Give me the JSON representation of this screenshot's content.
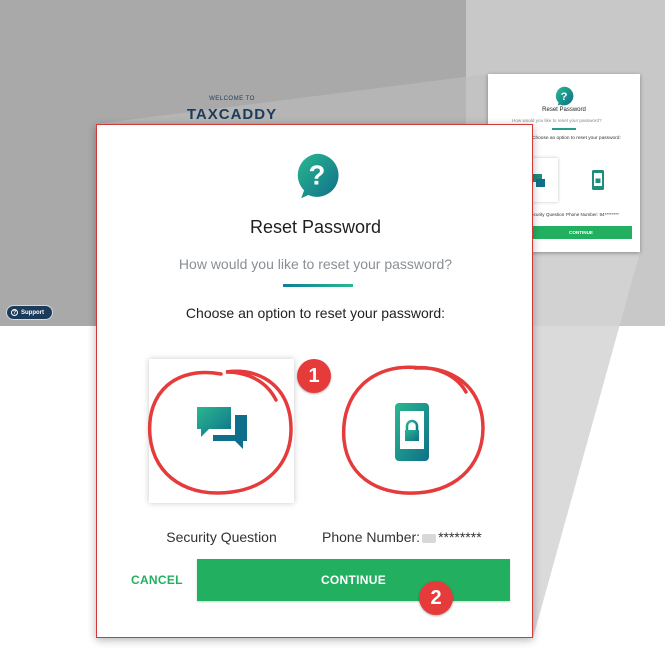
{
  "background": {
    "welcome": "WELCOME TO",
    "brand": "TAXCADDY",
    "support_label": "Support"
  },
  "mini_dialog": {
    "title": "Reset Password",
    "subtitle": "How would you like to reset your password?",
    "choose": "Choose an option to reset your password:",
    "option1_label": "Security Question",
    "option2_label": "Phone Number: 94********",
    "continue_label": "CONTINUE"
  },
  "dialog": {
    "title": "Reset Password",
    "subtitle": "How would you like to reset your password?",
    "choose": "Choose an option to reset your password:",
    "options": [
      {
        "label": "Security Question",
        "icon": "chat-bubbles-icon"
      },
      {
        "label_prefix": "Phone Number:",
        "label_suffix": "********",
        "icon": "locked-phone-icon"
      }
    ],
    "cancel_label": "CANCEL",
    "continue_label": "CONTINUE"
  },
  "annotations": {
    "badge_1": "1",
    "badge_2": "2"
  },
  "colors": {
    "accent_green": "#22b060",
    "brand_navy": "#1c3b5a",
    "teal": "#0f7f9a",
    "annotation_red": "#e53b3b"
  }
}
